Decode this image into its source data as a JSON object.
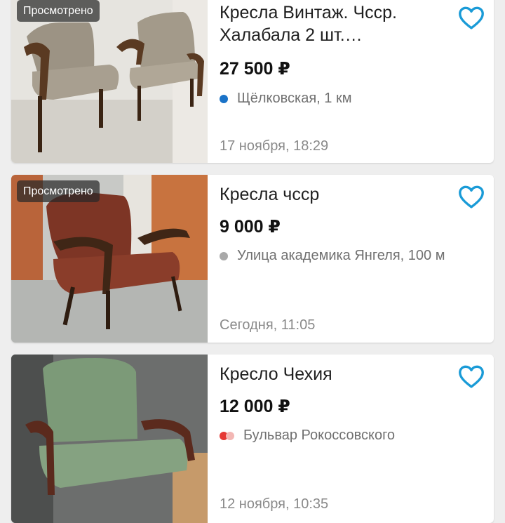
{
  "listings": [
    {
      "badge": "Просмотрено",
      "title": "Кресла Винтаж. Чсср. Халабала 2 шт.…",
      "price": "27 500 ₽",
      "location": "Щёлковская, 1 км",
      "location_marker_colors": [
        "#1a73c8"
      ],
      "date": "17 ноября, 18:29",
      "favorite_icon": "heart-outline-icon"
    },
    {
      "badge": "Просмотрено",
      "title": "Кресла чсср",
      "price": "9 000 ₽",
      "location": "Улица академика Янгеля, 100 м",
      "location_marker_colors": [
        "#a9a9a9"
      ],
      "date": "Сегодня, 11:05",
      "favorite_icon": "heart-outline-icon"
    },
    {
      "badge": "",
      "title": "Кресло Чехия",
      "price": "12 000 ₽",
      "location": "Бульвар Рокоссовского",
      "location_marker_colors": [
        "#e53935",
        "#f3b7b4"
      ],
      "date": "12 ноября, 10:35",
      "favorite_icon": "heart-outline-icon"
    }
  ],
  "colors": {
    "accent": "#1a9bd7",
    "background": "#eeeeee",
    "card": "#ffffff"
  }
}
